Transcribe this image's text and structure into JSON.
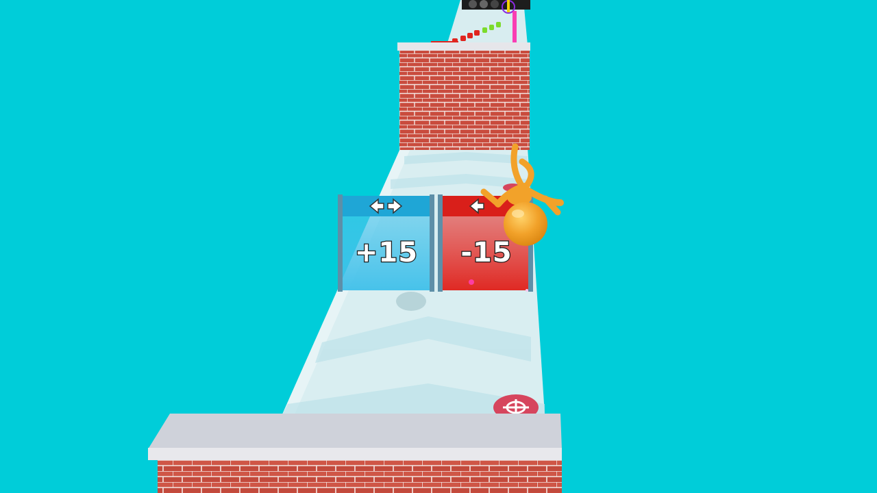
{
  "scene": {
    "background_color": "#00CDD9",
    "track_color": "#D9EEF1",
    "brick_color": "#C94C3E"
  },
  "gates": [
    {
      "label": "+15",
      "kind": "positive",
      "color": "#29B6E0",
      "header_color": "#1FA6D6",
      "arrow_icon": "double-arrow-left-right-icon"
    },
    {
      "label": "-15",
      "kind": "negative",
      "color": "#E0251F",
      "header_color": "#D91F1A",
      "arrow_icon": "double-arrow-right-left-icon"
    }
  ],
  "player": {
    "color": "#F2A22A",
    "pose": "flipping"
  },
  "markers": {
    "target_icon": "crosshair-target-icon",
    "target_color": "#D6455D"
  }
}
